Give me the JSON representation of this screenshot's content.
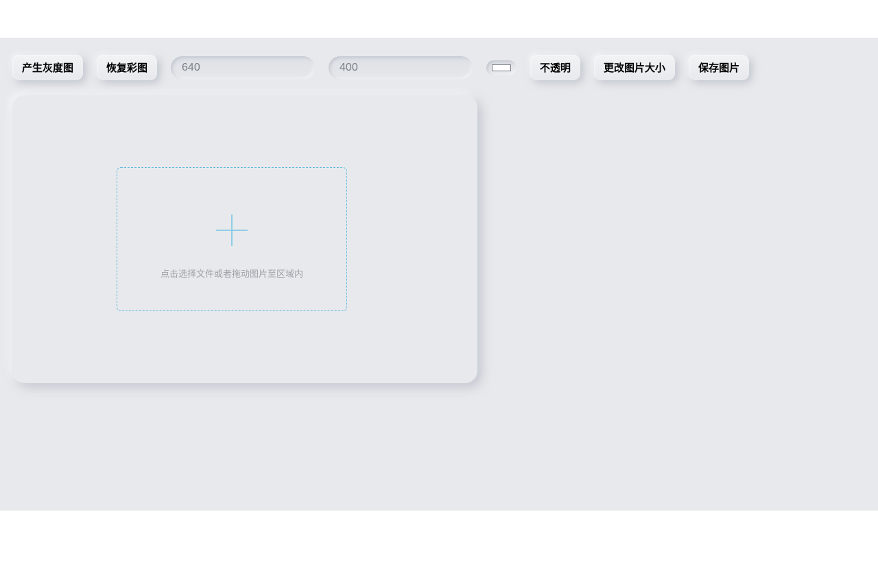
{
  "toolbar": {
    "grayscale_btn": "产生灰度图",
    "restore_color_btn": "恢复彩图",
    "width_placeholder": "640",
    "height_placeholder": "400",
    "opacity_btn": "不透明",
    "resize_btn": "更改图片大小",
    "save_btn": "保存图片",
    "color_value": "#ffffff"
  },
  "dropzone": {
    "hint_text": "点击选择文件或者拖动图片至区域内"
  }
}
